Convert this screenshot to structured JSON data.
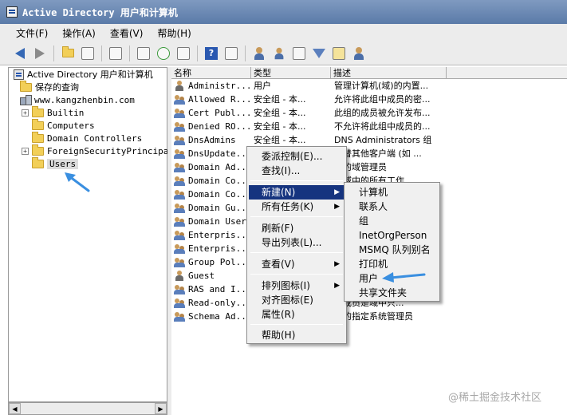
{
  "window": {
    "title": "Active Directory 用户和计算机"
  },
  "menubar": [
    "文件(F)",
    "操作(A)",
    "查看(V)",
    "帮助(H)"
  ],
  "toolbar": {
    "icons": [
      "back-arrow-icon",
      "forward-arrow-icon",
      "up-folder-icon",
      "show-tree-icon",
      "copy-icon",
      "properties-icon",
      "refresh-icon",
      "export-icon",
      "help-icon",
      "details-icon",
      "new-user-icon",
      "new-group-icon",
      "new-ou-icon",
      "filter-icon",
      "find-icon",
      "delegate-icon"
    ]
  },
  "tree": {
    "root": "Active Directory 用户和计算机",
    "saved_queries": "保存的查询",
    "domain": "www.kangzhenbin.com",
    "children": [
      "Builtin",
      "Computers",
      "Domain Controllers",
      "ForeignSecurityPrincipal",
      "Users"
    ],
    "expandable": [
      true,
      false,
      false,
      true,
      false
    ],
    "selected": "Users"
  },
  "list": {
    "columns": [
      "名称",
      "类型",
      "描述"
    ],
    "rows": [
      {
        "name": "Administr...",
        "type": "用户",
        "desc": "管理计算机(域)的内置...",
        "icon": "user"
      },
      {
        "name": "Allowed R...",
        "type": "安全组 - 本...",
        "desc": "允许将此组中成员的密...",
        "icon": "group"
      },
      {
        "name": "Cert Publ...",
        "type": "安全组 - 本...",
        "desc": "此组的成员被允许发布...",
        "icon": "group"
      },
      {
        "name": "Denied RO...",
        "type": "安全组 - 本...",
        "desc": "不允许将此组中成员的...",
        "icon": "group"
      },
      {
        "name": "DnsAdmins",
        "type": "安全组 - 本...",
        "desc": "DNS Administrators 组",
        "icon": "group"
      },
      {
        "name": "DnsUpdate...",
        "type": "",
        "desc": "许替其他客户端 (如 ...",
        "icon": "group"
      },
      {
        "name": "Domain Ad...",
        "type": "",
        "desc": "定的域管理员",
        "icon": "group"
      },
      {
        "name": "Domain Co...",
        "type": "",
        "desc": "到域中的所有工作...",
        "icon": "group"
      },
      {
        "name": "Domain Co...",
        "type": "",
        "desc": "",
        "icon": "group"
      },
      {
        "name": "Domain Gu...",
        "type": "",
        "desc": "",
        "icon": "group"
      },
      {
        "name": "Domain Users",
        "type": "",
        "desc": "",
        "icon": "group"
      },
      {
        "name": "Enterpris...",
        "type": "",
        "desc": "",
        "icon": "group"
      },
      {
        "name": "Enterpris...",
        "type": "",
        "desc": "",
        "icon": "group"
      },
      {
        "name": "Group Pol...",
        "type": "",
        "desc": "",
        "icon": "group"
      },
      {
        "name": "Guest",
        "type": "",
        "desc": "",
        "icon": "user"
      },
      {
        "name": "RAS and I...",
        "type": "",
        "desc": "",
        "icon": "group"
      },
      {
        "name": "Read-only...",
        "type": "",
        "desc": "的成员是域中只...",
        "icon": "group"
      },
      {
        "name": "Schema Ad...",
        "type": "",
        "desc": "构的指定系统管理员",
        "icon": "group"
      }
    ]
  },
  "context_menu": {
    "items": [
      {
        "label": "委派控制(E)...",
        "submenu": false
      },
      {
        "label": "查找(I)...",
        "submenu": false
      },
      {
        "label": "新建(N)",
        "submenu": true,
        "selected": true
      },
      {
        "label": "所有任务(K)",
        "submenu": true
      },
      {
        "label": "刷新(F)",
        "submenu": false
      },
      {
        "label": "导出列表(L)...",
        "submenu": false
      },
      {
        "label": "查看(V)",
        "submenu": true
      },
      {
        "label": "排列图标(I)",
        "submenu": true
      },
      {
        "label": "对齐图标(E)",
        "submenu": false
      },
      {
        "label": "属性(R)",
        "submenu": false
      },
      {
        "label": "帮助(H)",
        "submenu": false
      }
    ]
  },
  "submenu_new": {
    "items": [
      "计算机",
      "联系人",
      "组",
      "InetOrgPerson",
      "MSMQ 队列别名",
      "打印机",
      "用户",
      "共享文件夹"
    ]
  },
  "colors": {
    "selection": "#16347f",
    "annotation_arrow": "#3a8fe0",
    "titlebar": "#6b88b4"
  },
  "watermark": "@稀土掘金技术社区"
}
